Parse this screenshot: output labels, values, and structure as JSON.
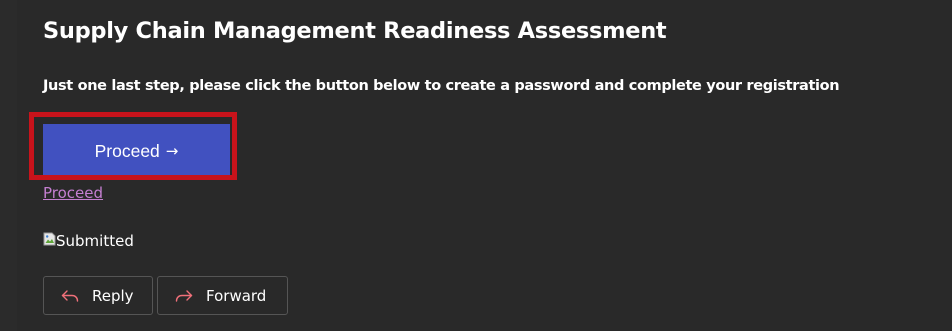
{
  "email": {
    "title": "Supply Chain Management Readiness Assessment",
    "instruction": "Just one last step, please click the button below to create a password and complete your registration",
    "proceed_button": {
      "label": "Proceed",
      "arrow": "→"
    },
    "proceed_link": "Proceed",
    "image_alt": "Submitted"
  },
  "actions": {
    "reply_label": "Reply",
    "forward_label": "Forward"
  },
  "icons": {
    "reply": "reply-icon",
    "forward": "forward-icon",
    "broken_image": "broken-image-icon"
  },
  "colors": {
    "background": "#292929",
    "button": "#4151c0",
    "highlight": "#c8131b",
    "link": "#c47fd0",
    "action_border": "#555555"
  }
}
